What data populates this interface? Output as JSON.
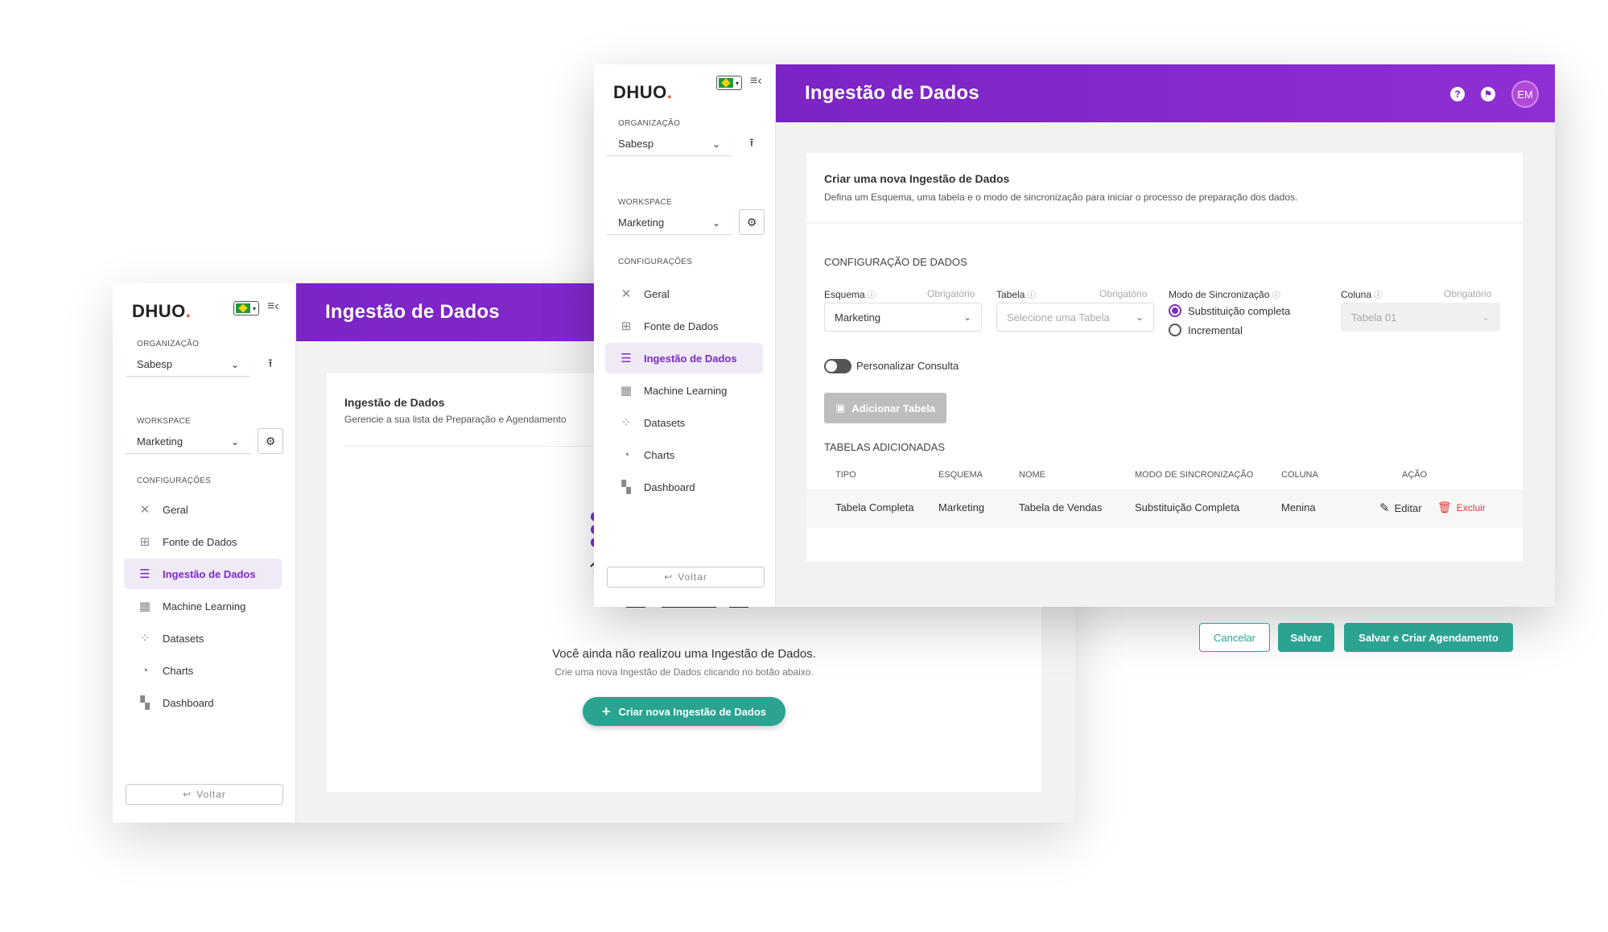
{
  "brand": {
    "name": "DHUO",
    "dot": "."
  },
  "sidebar": {
    "org_label": "ORGANIZAÇÃO",
    "org_value": "Sabesp",
    "ws_label": "WORKSPACE",
    "ws_value": "Marketing",
    "config_label": "CONFIGURAÇÕES",
    "items": [
      {
        "label": "Geral",
        "icon": "tools-icon"
      },
      {
        "label": "Fonte de  Dados",
        "icon": "datasource-icon"
      },
      {
        "label": "Ingestão de Dados",
        "icon": "ingestion-icon"
      },
      {
        "label": "Machine Learning",
        "icon": "ml-icon"
      },
      {
        "label": "Datasets",
        "icon": "datasets-icon"
      },
      {
        "label": "Charts",
        "icon": "pie-chart-icon"
      },
      {
        "label": "Dashboard",
        "icon": "dashboard-icon"
      }
    ],
    "back_label": "Voltar"
  },
  "back_window": {
    "title": "Ingestão de Dados",
    "card_title": "Ingestão de Dados",
    "card_subtitle": "Gerencie a sua lista de Preparação e Agendamento",
    "empty_title": "Você ainda não realizou uma Ingestão de Dados.",
    "empty_subtitle": "Crie uma nova Ingestão de Dados clicando no botão abaixo.",
    "create_label": "Criar nova Ingestão de Dados"
  },
  "front_window": {
    "title": "Ingestão de Dados",
    "avatar": "EM",
    "card_title": "Criar uma nova Ingestão de Dados",
    "card_subtitle": "Defina um Esquema, uma tabela e o modo de sincronização para iniciar o processo de preparação dos dados.",
    "config_section": "CONFIGURAÇÃO DE DADOS",
    "fields": {
      "schema_label": "Esquema",
      "schema_required": "Obrigatório",
      "schema_value": "Marketing",
      "table_label": "Tabela",
      "table_required": "Obrigatório",
      "table_placeholder": "Selecione uma Tabela",
      "sync_label": "Modo de Sincronização",
      "sync_options": [
        "Substituição completa",
        "Incremental"
      ],
      "column_label": "Coluna",
      "column_required": "Obrigatório",
      "column_value": "Tabela 01"
    },
    "custom_query_label": "Personalizar Consulta",
    "add_table_label": "Adicionar Tabela",
    "tables_section": "TABELAS ADICIONADAS",
    "table_headers": [
      "TIPO",
      "ESQUEMA",
      "NOME",
      "MODO DE SINCRONIZAÇÃO",
      "COLUNA",
      "AÇÃO"
    ],
    "rows": [
      {
        "tipo": "Tabela Completa",
        "esquema": "Marketing",
        "nome": "Tabela de Vendas",
        "modo": "Substituição Completa",
        "coluna": "Menina",
        "edit": "Editar",
        "delete": "Excluir"
      }
    ],
    "cancel_label": "Cancelar",
    "save_label": "Salvar",
    "save_schedule_label": "Salvar e Criar Agendamento"
  },
  "colors": {
    "primary": "#7b24c4",
    "teal": "#2aa491",
    "danger": "#e23b3b"
  }
}
